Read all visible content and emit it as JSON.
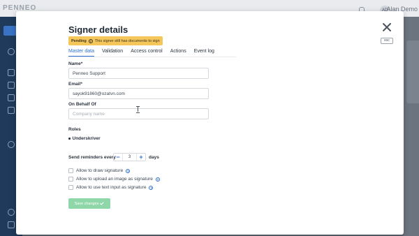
{
  "app": {
    "logo": "PENNEO",
    "user_initials": "AD",
    "user_name": "Alan Demo"
  },
  "modal": {
    "title": "Signer details",
    "esc_label": "esc",
    "status": {
      "label": "Pending",
      "message": "This signer still has documents to sign",
      "color": "#f5c65a"
    },
    "tabs": [
      {
        "label": "Master data",
        "active": true
      },
      {
        "label": "Validation",
        "active": false
      },
      {
        "label": "Access control",
        "active": false
      },
      {
        "label": "Actions",
        "active": false
      },
      {
        "label": "Event log",
        "active": false
      }
    ],
    "fields": {
      "name": {
        "label": "Name",
        "required": "*",
        "value": "Penneo Support"
      },
      "email": {
        "label": "Email",
        "required": "*",
        "value": "sayok91860@ozatvn.com"
      },
      "on_behalf_of": {
        "label": "On Behalf Of",
        "value": "",
        "placeholder": "Company name"
      }
    },
    "roles": {
      "label": "Roles",
      "items": [
        "Underskriver"
      ]
    },
    "reminders": {
      "label": "Send reminders every",
      "value": "3",
      "unit": "days",
      "decrement": "−",
      "increment": "+"
    },
    "options": [
      {
        "label": "Allow to draw signature",
        "checked": false
      },
      {
        "label": "Allow to upload an image as signature",
        "checked": false
      },
      {
        "label": "Allow to use text input as signature",
        "checked": false
      }
    ],
    "save_label": "Save changes",
    "accent_color": "#2e6fd0",
    "save_color": "#8fd6a8"
  }
}
